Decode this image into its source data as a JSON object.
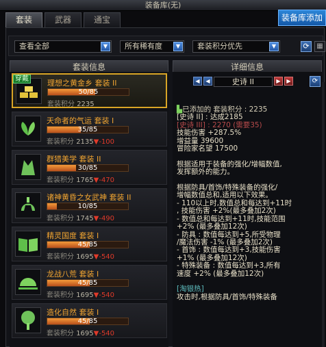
{
  "window": {
    "title": "装备库(无)"
  },
  "tabs": [
    {
      "label": "套装"
    },
    {
      "label": "武器"
    },
    {
      "label": "通宝"
    }
  ],
  "storage_button": "装备库添加",
  "filters": {
    "view": "查看全部",
    "rarity": "所有稀有度",
    "sort": "套装积分优先"
  },
  "headers": {
    "list": "套装信息",
    "detail": "详细信息"
  },
  "sets": [
    {
      "name": "理想之黄金乡 套装 II",
      "progress": "50/85",
      "score_label": "套装积分",
      "score": "2235",
      "diff": "",
      "badge": "穿戴"
    },
    {
      "name": "天命者的气运 套装 I",
      "progress": "35/85",
      "score_label": "套装积分",
      "score": "2135",
      "diff": "▼-100"
    },
    {
      "name": "群猎美学 套装 II",
      "progress": "30/85",
      "score_label": "套装积分",
      "score": "1765",
      "diff": "▼-470"
    },
    {
      "name": "诸神黄昏之女武神 套装 II",
      "progress": "10/85",
      "score_label": "套装积分",
      "score": "1745",
      "diff": "▼-490"
    },
    {
      "name": "精灵国度 套装 I",
      "progress": "45/85",
      "score_label": "套装积分",
      "score": "1695",
      "diff": "▼-540"
    },
    {
      "name": "龙战八荒 套装 I",
      "progress": "45/85",
      "score_label": "套装积分",
      "score": "1695",
      "diff": "▼-540"
    },
    {
      "name": "造化自然 套装 I",
      "progress": "45/85",
      "score_label": "套装积分",
      "score": "1695",
      "diff": "▼-540"
    }
  ],
  "set_fill": [
    0.588,
    0.412,
    0.353,
    0.118,
    0.529,
    0.529,
    0.529
  ],
  "detail": {
    "tier": "史诗 II",
    "lines": [
      {
        "t": "已添加的 套装积分 : 2235",
        "c": "g"
      },
      {
        "t": "[史诗 II] : 达成2185",
        "c": "w"
      },
      {
        "t": "[史诗 III] : 2270 (需要35)",
        "c": "r2"
      },
      {
        "t": "技能伤害 +287.5%",
        "c": "w"
      },
      {
        "t": "增益量 39600",
        "c": "w"
      },
      {
        "t": "冒险家名望 17500",
        "c": "w"
      },
      {
        "t": "",
        "c": "w"
      },
      {
        "t": "根据适用于装备的强化/增幅数值,",
        "c": "w"
      },
      {
        "t": "发挥额外的能力。",
        "c": "w"
      },
      {
        "t": "",
        "c": "w"
      },
      {
        "t": "根据防具/首饰/特殊装备的强化/",
        "c": "w"
      },
      {
        "t": "增幅数值总和,适用以下效果。",
        "c": "w"
      },
      {
        "t": "- 110以上时,数值总和每达到+11时",
        "c": "w"
      },
      {
        "t": ", 技能伤害 +2%(最多叠加2次)",
        "c": "w"
      },
      {
        "t": "- 数值总和每达到+11时,技能范围",
        "c": "w"
      },
      {
        "t": "+2% (最多叠加12次)",
        "c": "w"
      },
      {
        "t": "- 防具 : 数值每达到+5,所受物理",
        "c": "w"
      },
      {
        "t": "/魔法伤害 -1% (最多叠加2次)",
        "c": "w"
      },
      {
        "t": "- 首饰 : 数值每达到+3,技能伤害",
        "c": "w"
      },
      {
        "t": "+1% (最多叠加12次)",
        "c": "w"
      },
      {
        "t": "- 特殊装备 : 数值每达到+3,所有",
        "c": "w"
      },
      {
        "t": "速度 +2% (最多叠加12次)",
        "c": "w"
      },
      {
        "t": "",
        "c": "w"
      },
      {
        "t": "[淘银热]",
        "c": "cy"
      },
      {
        "t": "攻击时,根据防具/首饰/特殊装备",
        "c": "w"
      }
    ]
  }
}
